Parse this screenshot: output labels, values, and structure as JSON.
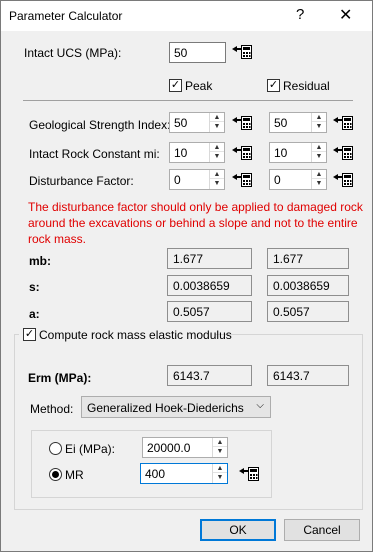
{
  "window": {
    "title": "Parameter Calculator",
    "help": "?",
    "close": "✕"
  },
  "ucs": {
    "label": "Intact UCS (MPa):",
    "value": "50"
  },
  "columns": {
    "peak": "Peak",
    "residual": "Residual",
    "peak_checked": true,
    "residual_checked": true
  },
  "inputs": [
    {
      "label": "Geological Strength Index:",
      "peak": "50",
      "residual": "50"
    },
    {
      "label": "Intact Rock Constant mi:",
      "peak": "10",
      "residual": "10"
    },
    {
      "label": "Disturbance Factor:",
      "peak": "0",
      "residual": "0"
    }
  ],
  "warning": "The disturbance factor should only be applied to damaged rock around the excavations or behind a slope and not to the entire rock mass.",
  "outputs": [
    {
      "label": "mb:",
      "peak": "1.677",
      "residual": "1.677"
    },
    {
      "label": "s:",
      "peak": "0.0038659",
      "residual": "0.0038659"
    },
    {
      "label": "a:",
      "peak": "0.5057",
      "residual": "0.5057"
    }
  ],
  "elastic": {
    "checkbox_label": "Compute rock mass elastic modulus",
    "checked": true,
    "erm_label": "Erm (MPa):",
    "erm_peak": "6143.7",
    "erm_residual": "6143.7",
    "method_label": "Method:",
    "method_value": "Generalized Hoek-Diederichs",
    "ei_label": "Ei (MPa):",
    "ei_value": "20000.0",
    "mr_label": "MR",
    "mr_value": "400",
    "selected": "MR"
  },
  "buttons": {
    "ok": "OK",
    "cancel": "Cancel"
  }
}
